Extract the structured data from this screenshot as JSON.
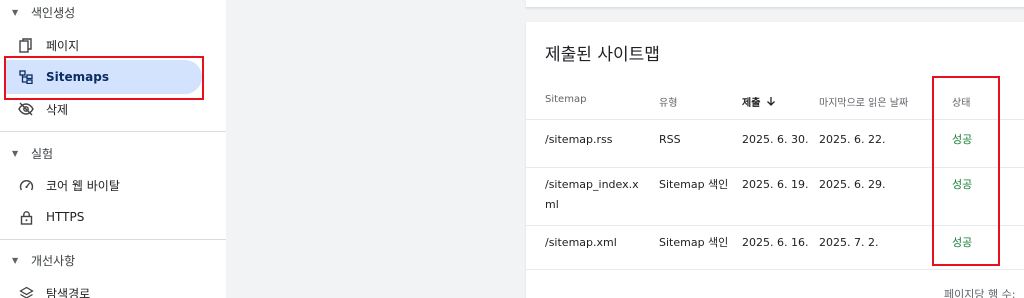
{
  "sidebar": {
    "sections": [
      {
        "label": "색인생성"
      },
      {
        "label": "실험"
      },
      {
        "label": "개선사항"
      }
    ],
    "items": [
      {
        "label": "페이지",
        "icon": "pages-icon"
      },
      {
        "label": "Sitemaps",
        "icon": "sitemap-icon"
      },
      {
        "label": "삭제",
        "icon": "visibility-off-icon"
      },
      {
        "label": "코어 웹 바이탈",
        "icon": "speed-gauge-icon"
      },
      {
        "label": "HTTPS",
        "icon": "lock-icon"
      },
      {
        "label": "탐색경로",
        "icon": "layers-icon"
      }
    ]
  },
  "main": {
    "card_title": "제출된 사이트맵",
    "columns": [
      "Sitemap",
      "유형",
      "제출",
      "마지막으로 읽은 날짜",
      "상태"
    ],
    "sort_icon": "arrow-down-icon",
    "rows": [
      {
        "sitemap": "/sitemap.rss",
        "type": "RSS",
        "submitted": "2025. 6. 30.",
        "last_read": "2025. 6. 22.",
        "status": "성공"
      },
      {
        "sitemap": "/sitemap_index.x",
        "sitemap_2": "ml",
        "type": "Sitemap 색인",
        "submitted": "2025. 6. 19.",
        "last_read": "2025. 6. 29.",
        "status": "성공"
      },
      {
        "sitemap": "/sitemap.xml",
        "type": "Sitemap 색인",
        "submitted": "2025. 6. 16.",
        "last_read": "2025. 7. 2.",
        "status": "성공"
      }
    ],
    "footer": "페이지당 행 수:"
  },
  "colors": {
    "highlight": "#e8101c",
    "active_bg": "#d3e3fd",
    "success": "#188038"
  }
}
